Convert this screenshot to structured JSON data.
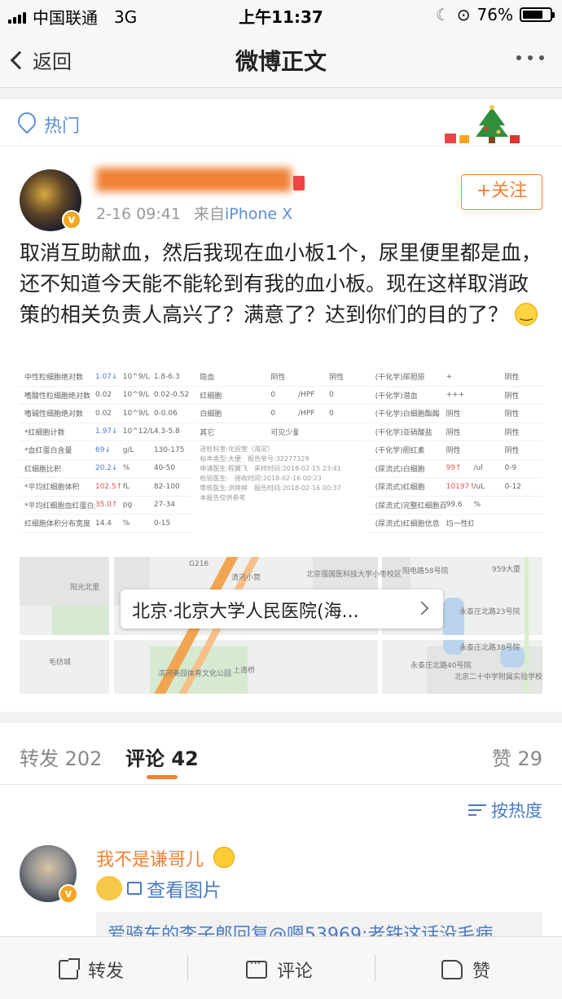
{
  "status_bar": {
    "carrier": "中国联通",
    "network": "3G",
    "time": "上午11:37",
    "battery": "76%",
    "battery_level": 0.76
  },
  "nav": {
    "back_label": "返回",
    "title": "微博正文"
  },
  "post": {
    "hot_label": "热门",
    "username": "████████████",
    "timestamp": "2-16 09:41",
    "source_prefix": "来自",
    "source": "iPhone X",
    "follow_label": "+关注",
    "text": "取消互助献血，然后我现在血小板1个，尿里便里都是血，还不知道今天能不能轮到有我的血小板。现在这样取消政策的相关负责人高兴了？满意了？达到你们的目的了？"
  },
  "lab_reports": [
    {
      "rows": [
        [
          "中性粒细胞绝对数",
          "1.07↓",
          "10^9/L",
          "1.8-6.3"
        ],
        [
          "嗜酸性粒细胞绝对数",
          "0.02",
          "10^9/L",
          "0.02-0.52"
        ],
        [
          "嗜碱性细胞绝对数",
          "0.02",
          "10^9/L",
          "0-0.06"
        ],
        [
          "*红细胞计数",
          "1.97↓",
          "10^12/L",
          "4.3-5.8"
        ],
        [
          "*血红蛋白含量",
          "69↓",
          "g/L",
          "130-175"
        ],
        [
          "红细胞比积",
          "20.2↓",
          "%",
          "40-50"
        ],
        [
          "*平均红细胞体积",
          "102.5↑",
          "fL",
          "82-100"
        ],
        [
          "*平均红细胞血红蛋白量",
          "35.0↑",
          "pg",
          "27-34"
        ],
        [
          "红细胞体积分布宽度",
          "14.4",
          "%",
          "0-15"
        ]
      ]
    },
    {
      "rows": [
        [
          "隐血",
          "阴性",
          "",
          "阴性"
        ],
        [
          "红细胞",
          "0",
          "/HPF",
          "0"
        ],
        [
          "白细胞",
          "0",
          "/HPF",
          "0"
        ],
        [
          "其它",
          "可见少量脂肪滴",
          "",
          ""
        ]
      ],
      "notes": [
        "送检科室:化验室（海淀）",
        "标本类型:大便　报告单号:32277329",
        "申请医生:程翼飞　采样时间:2018-02-15 23:41",
        "检验医生:　接收时间:2018-02-16 00:23",
        "审核医生:洪婷婷　报告时间:2018-02-16 00:37",
        "本报告仅供参考"
      ]
    },
    {
      "rows": [
        [
          "(干化学)尿胆原",
          "+",
          "",
          "阴性"
        ],
        [
          "(干化学)潜血",
          "+++",
          "",
          "阴性"
        ],
        [
          "(干化学)白细胞酯酶",
          "阴性",
          "",
          "阴性"
        ],
        [
          "(干化学)亚硝酸盐",
          "阴性",
          "",
          "阴性"
        ],
        [
          "(干化学)胆红素",
          "阴性",
          "",
          "阴性"
        ],
        [
          "(尿流式)白细胞",
          "99↑",
          "/ul",
          "0-9"
        ],
        [
          "(尿流式)红细胞",
          "10197↑",
          "/uL",
          "0-12"
        ],
        [
          "(尿流式)完整红细胞百分比",
          "99.6",
          "%",
          ""
        ],
        [
          "(尿流式)红细胞信息",
          "均一性红细胞?",
          "",
          ""
        ]
      ]
    }
  ],
  "map": {
    "location": "北京·北京大学人民医院(海...",
    "labels": [
      "阳光北里",
      "毛纺城",
      "滨河美园体育文化公园",
      "上清桥",
      "北京强国医科技大学小枣校区",
      "阳电路58号院",
      "永泰庄北路23号院",
      "永泰庄北路38号院",
      "永泰庄北路40号院",
      "北京二十中学附属实验学校",
      "清河小营",
      "G216",
      "959大厦"
    ]
  },
  "tabs": {
    "repost_label": "转发",
    "repost_count": "202",
    "comment_label": "评论",
    "comment_count": "42",
    "like_label": "赞",
    "like_count": "29"
  },
  "comments": {
    "sort_label": "按热度",
    "items": [
      {
        "name": "我不是谦哥儿",
        "body": "查看图片",
        "reply_preview": "爱骑车的李子郎回复@嗯53969:老铁这话没毛病"
      }
    ]
  },
  "toolbar": {
    "repost": "转发",
    "comment": "评论",
    "like": "赞"
  },
  "colors": {
    "accent_orange": "#f08135",
    "link_blue": "#4a7bc4",
    "hot_blue": "#5b8fd6"
  }
}
